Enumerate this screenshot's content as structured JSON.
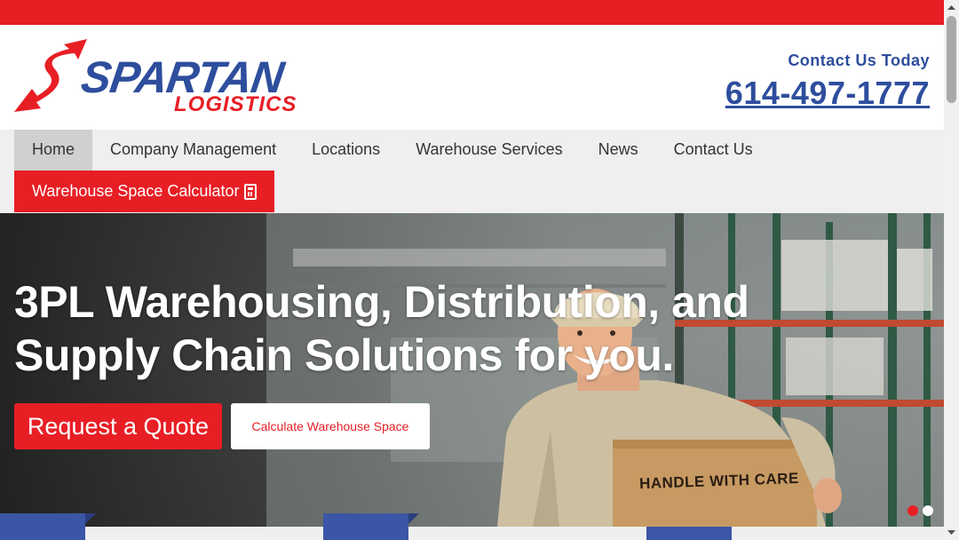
{
  "brand": {
    "name": "SPARTAN",
    "tagline": "LOGISTICS",
    "colors": {
      "blue": "#2e4e9d",
      "red": "#e81e25"
    }
  },
  "header": {
    "contact_label": "Contact  Us Today",
    "phone": "614-497-1777"
  },
  "nav": {
    "items": [
      {
        "label": "Home",
        "active": true
      },
      {
        "label": "Company Management"
      },
      {
        "label": "Locations"
      },
      {
        "label": "Warehouse Services"
      },
      {
        "label": "News"
      },
      {
        "label": "Contact Us"
      }
    ],
    "calculator": {
      "label": "Warehouse Space Calculator",
      "icon": "calculator-icon"
    }
  },
  "hero": {
    "title": "3PL Warehousing, Distribution, and Supply Chain Solutions for you.",
    "primary_button": "Request a Quote",
    "secondary_button": "Calculate Warehouse Space",
    "box_label": "HANDLE WITH CARE",
    "slides": {
      "count": 2,
      "active": 0,
      "active_color": "#e81e25",
      "inactive_color": "#ffffff"
    }
  }
}
